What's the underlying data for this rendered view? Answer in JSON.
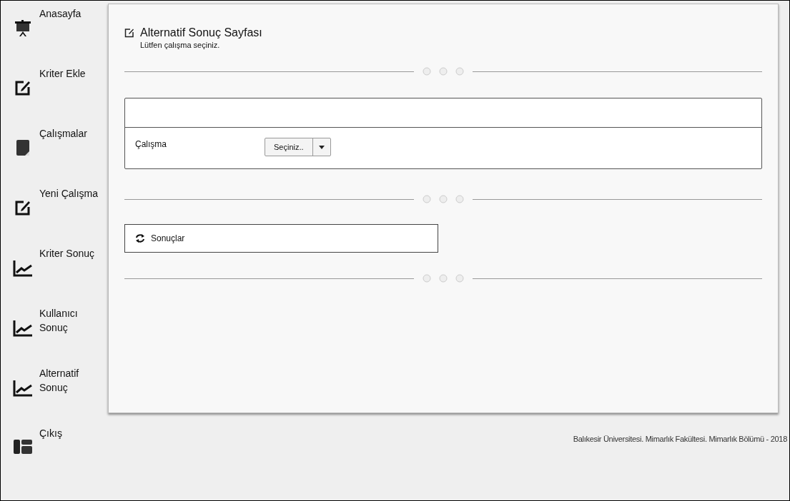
{
  "sidebar": {
    "items": [
      {
        "label": "Anasayfa",
        "kind": "board"
      },
      {
        "label": "Kriter Ekle",
        "kind": "edit"
      },
      {
        "label": "Çalışmalar",
        "kind": "note"
      },
      {
        "label": "Yeni Çalışma",
        "kind": "edit"
      },
      {
        "label": "Kriter Sonuç",
        "kind": "chart"
      },
      {
        "label": "Kullanıcı Sonuç",
        "kind": "chart"
      },
      {
        "label": "Alternatif Sonuç",
        "kind": "chart"
      },
      {
        "label": "Çıkış",
        "kind": "panel"
      }
    ]
  },
  "page": {
    "title": "Alternatif Sonuç Sayfası",
    "subtitle": "Lütfen çalışma seçiniz."
  },
  "form": {
    "field_label": "Çalışma",
    "select_value": "Seçiniz.."
  },
  "results_button": {
    "label": "Sonuçlar"
  },
  "footer": "Balıkesir Üniversitesi. Mimarlık Fakültesi. Mimarlık Bölümü - 2018"
}
